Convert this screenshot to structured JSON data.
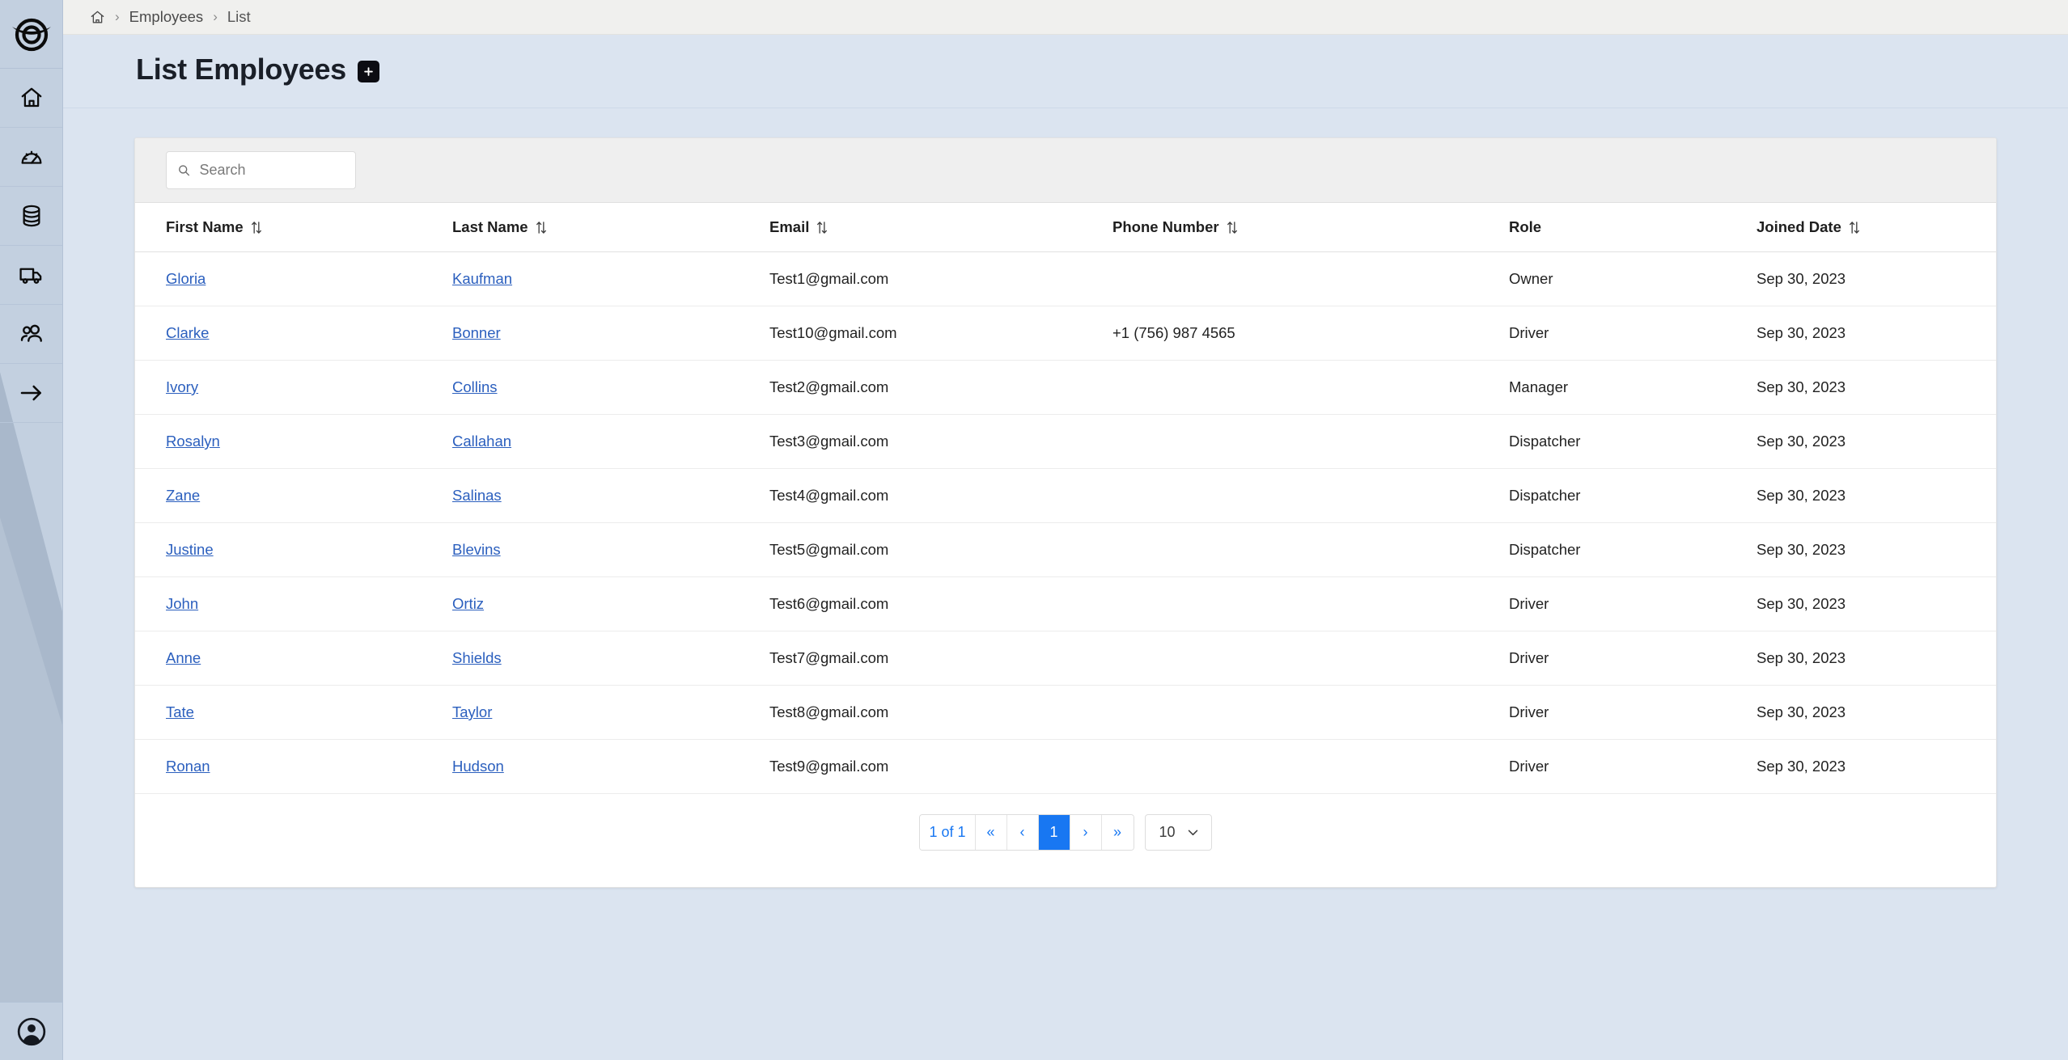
{
  "app": {
    "logo_icon": "company-logo-icon",
    "accent_color": "#1877f2",
    "sidebar_bg": "#c3d0e0",
    "link_color": "#2b5fbe"
  },
  "sidebar": {
    "items": [
      {
        "icon": "home-icon",
        "name": "sidebar-item-home"
      },
      {
        "icon": "gauge-icon",
        "name": "sidebar-item-dashboard"
      },
      {
        "icon": "database-icon",
        "name": "sidebar-item-database"
      },
      {
        "icon": "truck-icon",
        "name": "sidebar-item-vehicles"
      },
      {
        "icon": "users-icon",
        "name": "sidebar-item-employees"
      },
      {
        "icon": "arrow-right-icon",
        "name": "sidebar-item-expand"
      }
    ],
    "account_icon": "user-circle-icon"
  },
  "breadcrumb": {
    "home_icon": "home-icon",
    "separator": "›",
    "items": [
      {
        "label": "Employees",
        "link": true
      },
      {
        "label": "List",
        "link": false
      }
    ]
  },
  "header": {
    "title": "List Employees",
    "add_button_label": "+",
    "add_button_icon": "plus-icon"
  },
  "search": {
    "icon": "search-icon",
    "placeholder": "Search",
    "value": ""
  },
  "table": {
    "columns": [
      {
        "label": "First Name",
        "sortable": true,
        "key": "first_name"
      },
      {
        "label": "Last Name",
        "sortable": true,
        "key": "last_name"
      },
      {
        "label": "Email",
        "sortable": true,
        "key": "email"
      },
      {
        "label": "Phone Number",
        "sortable": true,
        "key": "phone"
      },
      {
        "label": "Role",
        "sortable": false,
        "key": "role"
      },
      {
        "label": "Joined Date",
        "sortable": true,
        "key": "joined"
      }
    ],
    "rows": [
      {
        "first_name": "Gloria",
        "last_name": "Kaufman",
        "email": "Test1@gmail.com",
        "phone": "",
        "role": "Owner",
        "joined": "Sep 30, 2023"
      },
      {
        "first_name": "Clarke",
        "last_name": "Bonner",
        "email": "Test10@gmail.com",
        "phone": "+1 (756) 987 4565",
        "role": "Driver",
        "joined": "Sep 30, 2023"
      },
      {
        "first_name": "Ivory",
        "last_name": "Collins",
        "email": "Test2@gmail.com",
        "phone": "",
        "role": "Manager",
        "joined": "Sep 30, 2023"
      },
      {
        "first_name": "Rosalyn",
        "last_name": "Callahan",
        "email": "Test3@gmail.com",
        "phone": "",
        "role": "Dispatcher",
        "joined": "Sep 30, 2023"
      },
      {
        "first_name": "Zane",
        "last_name": "Salinas",
        "email": "Test4@gmail.com",
        "phone": "",
        "role": "Dispatcher",
        "joined": "Sep 30, 2023"
      },
      {
        "first_name": "Justine",
        "last_name": "Blevins",
        "email": "Test5@gmail.com",
        "phone": "",
        "role": "Dispatcher",
        "joined": "Sep 30, 2023"
      },
      {
        "first_name": "John",
        "last_name": "Ortiz",
        "email": "Test6@gmail.com",
        "phone": "",
        "role": "Driver",
        "joined": "Sep 30, 2023"
      },
      {
        "first_name": "Anne",
        "last_name": "Shields",
        "email": "Test7@gmail.com",
        "phone": "",
        "role": "Driver",
        "joined": "Sep 30, 2023"
      },
      {
        "first_name": "Tate",
        "last_name": "Taylor",
        "email": "Test8@gmail.com",
        "phone": "",
        "role": "Driver",
        "joined": "Sep 30, 2023"
      },
      {
        "first_name": "Ronan",
        "last_name": "Hudson",
        "email": "Test9@gmail.com",
        "phone": "",
        "role": "Driver",
        "joined": "Sep 30, 2023"
      }
    ]
  },
  "pagination": {
    "info": "1 of 1",
    "first_label": "«",
    "prev_label": "‹",
    "next_label": "›",
    "last_label": "»",
    "pages": [
      "1"
    ],
    "current_page": "1",
    "page_size": "10",
    "page_size_icon": "chevron-down-icon"
  }
}
